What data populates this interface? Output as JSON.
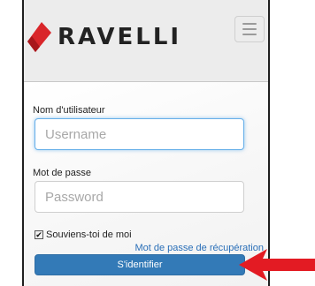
{
  "header": {
    "brand": "RAVELLI",
    "logo_icon": "ravelli-flame-logo",
    "menu_icon": "hamburger-menu-icon"
  },
  "login_form": {
    "username_label": "Nom d'utilisateur",
    "username_placeholder": "Username",
    "username_value": "",
    "password_label": "Mot de passe",
    "password_placeholder": "Password",
    "password_value": "",
    "remember_label": "Souviens-toi de moi",
    "remember_checked": true,
    "recover_link": "Mot de passe de récupération",
    "submit_label": "S'identifier"
  },
  "annotation": {
    "arrow_color": "#e31b23",
    "arrow_icon": "red-arrow-pointing-left"
  },
  "colors": {
    "brand_red": "#d9262a",
    "button_blue": "#337ab7",
    "link_blue": "#2a6fb8",
    "focus_blue": "#66afe9"
  }
}
